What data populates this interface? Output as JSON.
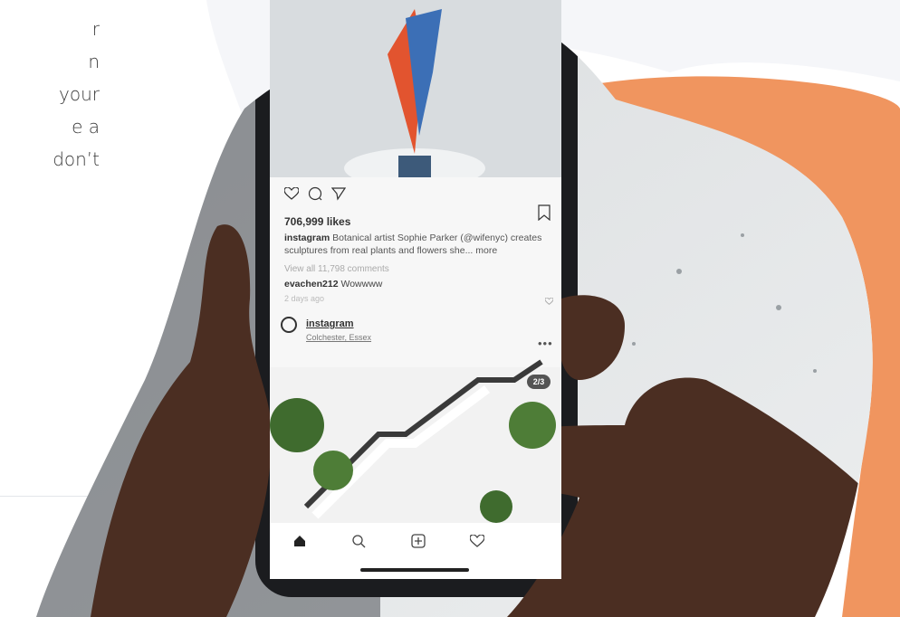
{
  "intro_text_fragments": [
    "r",
    "n",
    "your",
    "e a",
    "don’t"
  ],
  "colors": {
    "background_grey": "#f5f6f9",
    "accent_orange": "#f0955f",
    "text_dark": "#3a3a3a"
  },
  "instagram_post": {
    "likes": "706,999 likes",
    "caption_user": "instagram",
    "caption_text": "Botanical artist Sophie Parker (@wifenyc) creates sculptures from real plants and flowers she... more",
    "view_all": "View all 11,798 comments",
    "comment_user": "evachen212",
    "comment_text": "Wowwww",
    "time_ago": "2 days ago"
  },
  "next_post": {
    "username": "instagram",
    "location": "Colchester, Essex",
    "carousel_counter": "2/3"
  },
  "tabbar_icons": [
    "home-icon",
    "search-icon",
    "add-post-icon",
    "heart-icon"
  ]
}
